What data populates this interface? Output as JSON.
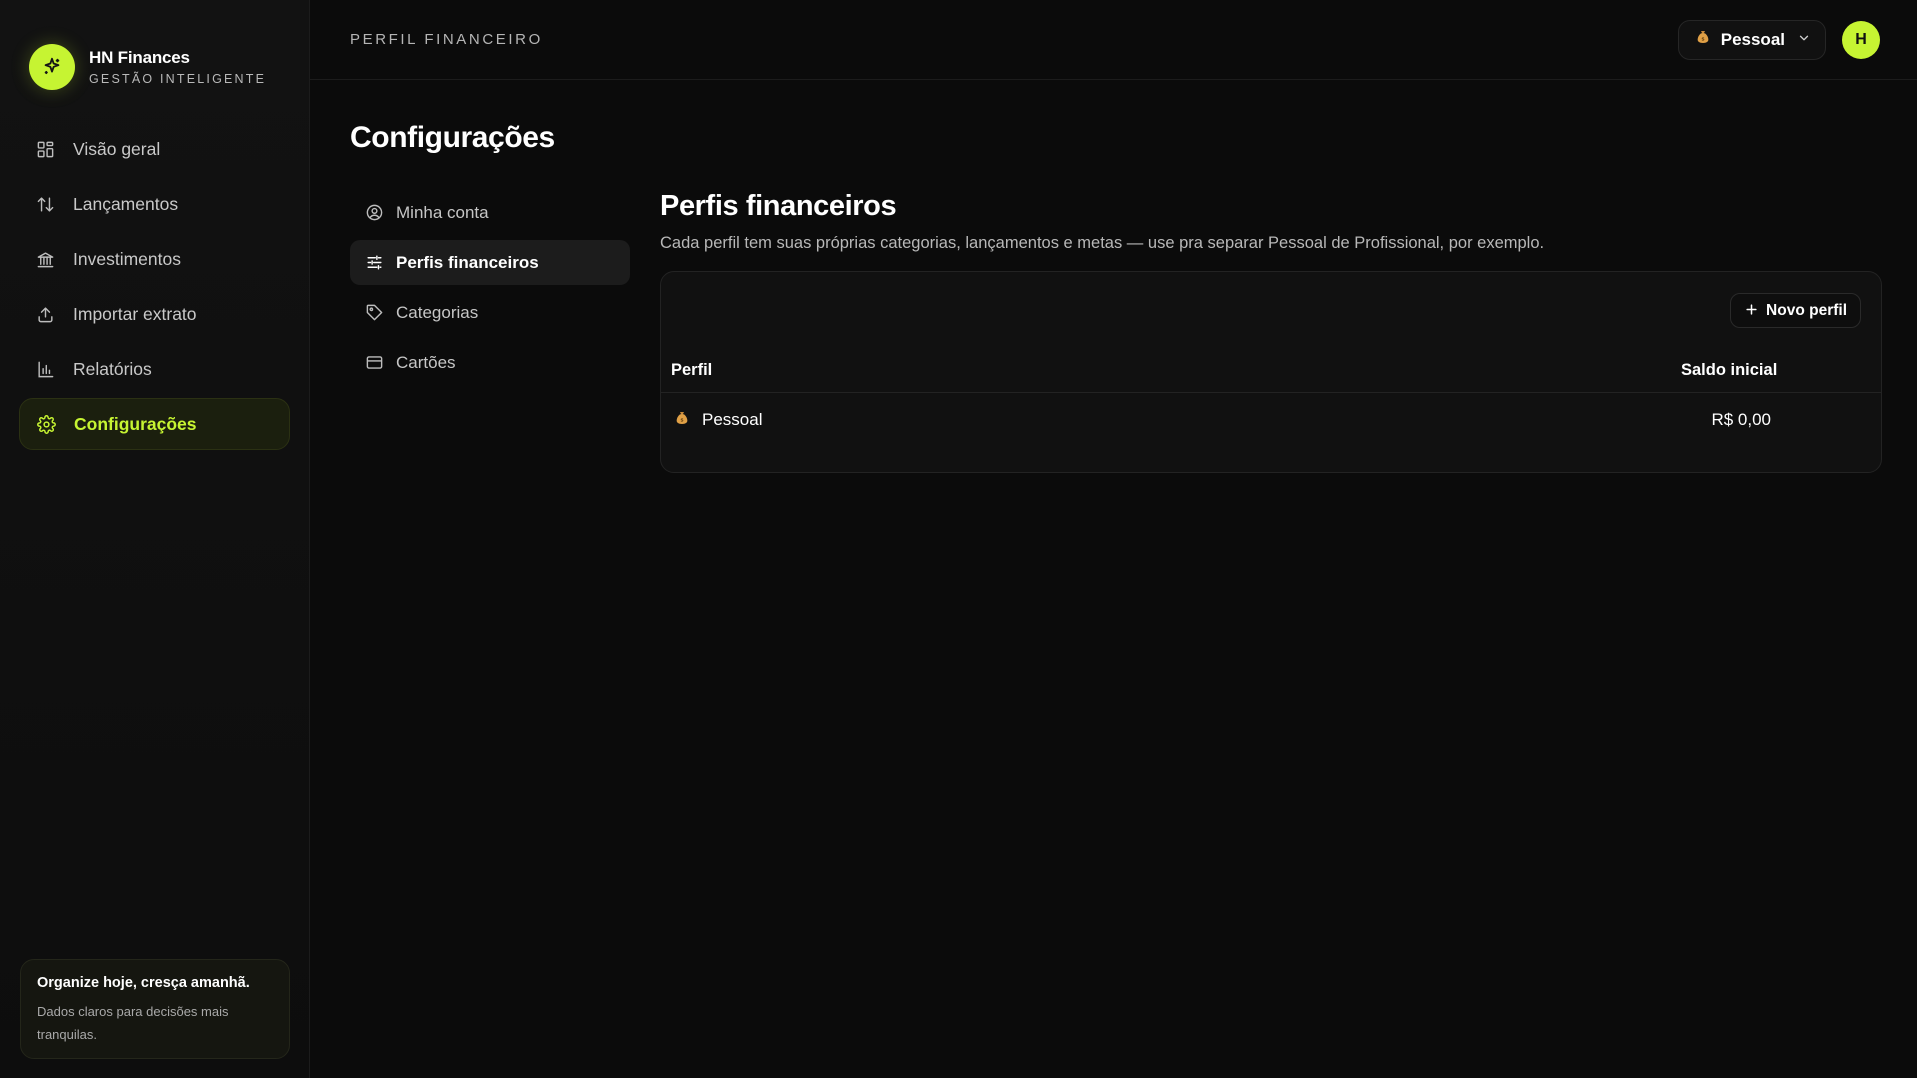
{
  "brand": {
    "name": "HN Finances",
    "subtitle": "GESTÃO INTELIGENTE"
  },
  "sidebar": {
    "items": [
      {
        "label": "Visão geral",
        "icon": "grid-icon"
      },
      {
        "label": "Lançamentos",
        "icon": "arrows-up-down-icon"
      },
      {
        "label": "Investimentos",
        "icon": "bank-icon"
      },
      {
        "label": "Importar extrato",
        "icon": "upload-icon"
      },
      {
        "label": "Relatórios",
        "icon": "bar-chart-icon"
      },
      {
        "label": "Configurações",
        "icon": "gear-icon",
        "active": true
      }
    ],
    "promo": {
      "title": "Organize hoje, cresça amanhã.",
      "text": "Dados claros para decisões mais tranquilas."
    }
  },
  "topbar": {
    "title": "PERFIL FINANCEIRO",
    "profile_selector": "Pessoal",
    "avatar_initial": "H"
  },
  "page": {
    "title": "Configurações"
  },
  "settings_nav": [
    {
      "label": "Minha conta",
      "icon": "user-circle-icon"
    },
    {
      "label": "Perfis financeiros",
      "icon": "sliders-icon",
      "active": true
    },
    {
      "label": "Categorias",
      "icon": "tag-icon"
    },
    {
      "label": "Cartões",
      "icon": "credit-card-icon"
    }
  ],
  "profiles_section": {
    "title": "Perfis financeiros",
    "description": "Cada perfil tem suas próprias categorias, lançamentos e metas — use pra separar Pessoal de Profissional, por exemplo.",
    "new_button": "Novo perfil",
    "columns": [
      "Perfil",
      "Saldo inicial"
    ],
    "rows": [
      {
        "name": "Pessoal",
        "balance": "R$ 0,00",
        "icon": "money-bag-icon"
      }
    ]
  },
  "colors": {
    "accent": "#c6f432",
    "background": "#0b0b0b"
  }
}
